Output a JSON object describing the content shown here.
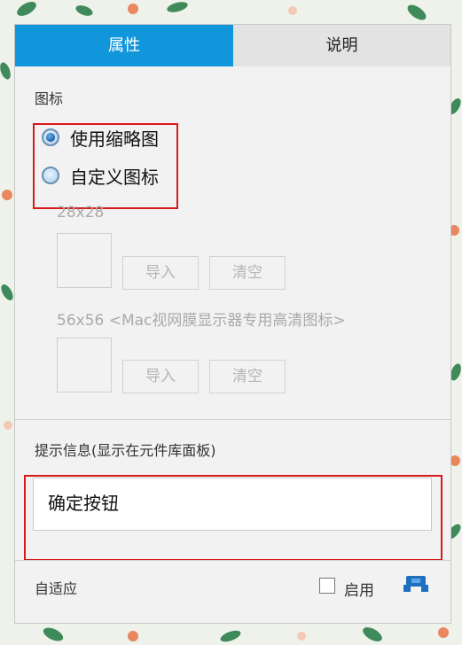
{
  "tabs": {
    "active_label": "属性",
    "inactive_label": "说明"
  },
  "icon_section": {
    "title": "图标",
    "options": [
      {
        "label": "使用缩略图",
        "checked": true
      },
      {
        "label": "自定义图标",
        "checked": false
      }
    ],
    "size_small": "28x28",
    "size_large": "56x56 <Mac视网膜显示器专用高清图标>",
    "import_label": "导入",
    "clear_label": "清空"
  },
  "tooltip_section": {
    "title": "提示信息(显示在元件库面板)",
    "value": "确定按钮"
  },
  "adaptive": {
    "label": "自适应",
    "checkbox_label": "启用",
    "checked": false
  },
  "colors": {
    "accent": "#1296db",
    "highlight": "#d61a1a"
  },
  "icons": [
    "radio-checked-icon",
    "radio-unchecked-icon",
    "checkbox-icon",
    "blue-component-icon"
  ]
}
